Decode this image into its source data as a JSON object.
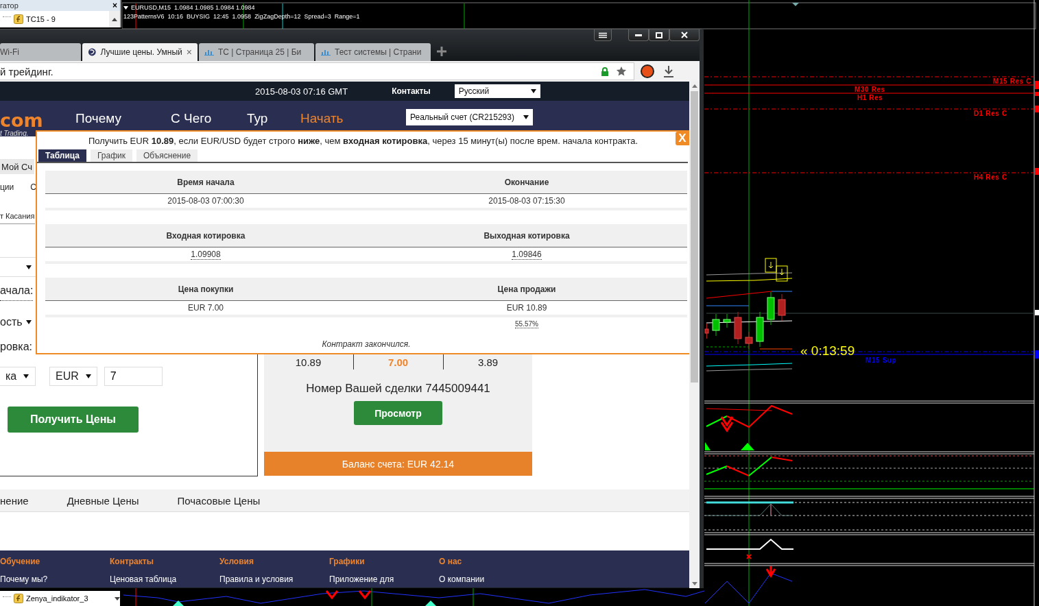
{
  "navigator": {
    "title": "гатор",
    "close": "×",
    "items": [
      {
        "label": "TC15 - 9"
      }
    ],
    "bottom_item": "Zenya_indikator_3"
  },
  "chart": {
    "header": [
      "EURUSD,M15  1.0984 1.0985 1.0984 1.0984",
      "123PatternsV6  10:16  BUYSIG  12:45  1.0958  ZigZagDepth=12  Spread=3  Range=1"
    ],
    "levels": [
      {
        "label": "M15 Res C",
        "color": "#ff0000"
      },
      {
        "label": "M30 Res",
        "color": "#ff0000"
      },
      {
        "label": "H1 Res",
        "color": "#ff0000"
      },
      {
        "label": "D1 Res C",
        "color": "#ff0000"
      },
      {
        "label": "H4 Res C",
        "color": "#ff0000"
      },
      {
        "label": "M15 Sup",
        "color": "#0000ff"
      }
    ],
    "timer": "« 0:13:59"
  },
  "browser": {
    "tabs": [
      {
        "label": "Wi-Fi",
        "selected": false
      },
      {
        "label": "Лучшие цены. Умный",
        "selected": true,
        "close": "×"
      },
      {
        "label": "ТС | Страница 25 | Би",
        "selected": false
      },
      {
        "label": "Тест системы | Страни",
        "selected": false
      }
    ],
    "address": "й трейдинг."
  },
  "site": {
    "datetime": "2015-08-03 07:16 GMT",
    "contacts": "Контакты",
    "language": "Русский",
    "logo": "com",
    "tagline": "t Trading.",
    "nav": [
      {
        "label": "Почему",
        "highlighted": false
      },
      {
        "label": "С Чего",
        "highlighted": false
      },
      {
        "label": "Тур",
        "highlighted": false
      },
      {
        "label": "Начать",
        "highlighted": true
      }
    ],
    "account": "Реальный счет (CR215293)",
    "form": {
      "tab": "Мой Сч",
      "links": [
        "ции",
        "С"
      ],
      "contract_type": "т Касания",
      "start_label": "ачала:",
      "duration": "ость",
      "barrier_label": "ровка:",
      "basis": "ка",
      "currency": "EUR",
      "amount": "7",
      "submit": "Получить Цены"
    },
    "quote": {
      "payouts": [
        {
          "value": "10.89",
          "highlighted": false
        },
        {
          "value": "7.00",
          "highlighted": true
        },
        {
          "value": "3.89",
          "highlighted": false
        }
      ],
      "trade_id": "Номер Вашей сделки 7445009441",
      "view": "Просмотр",
      "balance": "Баланс счета: EUR 42.14"
    },
    "tabs": [
      "нение",
      "Дневные Цены",
      "Почасовые Цены"
    ],
    "footer": [
      {
        "heading": "Обучение",
        "link": "Почему мы?"
      },
      {
        "heading": "Контракты",
        "link": "Ценовая таблица"
      },
      {
        "heading": "Условия",
        "link": "Правила и условия"
      },
      {
        "heading": "Графики",
        "link": "Приложение для"
      },
      {
        "heading": "О нас",
        "link": "О компании"
      }
    ]
  },
  "popup": {
    "message": "Получить EUR **10.89**, если EUR/USD будет строго **ниже**, чем **входная котировка**, через 15 минут(ы) после врем. начала контракта.",
    "close": "X",
    "tabs": [
      {
        "label": "Таблица",
        "selected": true
      },
      {
        "label": "График",
        "selected": false
      },
      {
        "label": "Объяснение",
        "selected": false
      }
    ],
    "sections": [
      {
        "kind": "plain",
        "headers": [
          "Время начала",
          "Окончание"
        ],
        "values": [
          "2015-08-03 07:00:30",
          "2015-08-03 07:15:30"
        ]
      },
      {
        "kind": "quote",
        "headers": [
          "Входная котировка",
          "Выходная котировка"
        ],
        "values": [
          "1.09908",
          "1.09846"
        ]
      },
      {
        "kind": "plain",
        "headers": [
          "Цена покупки",
          "Цена продажи"
        ],
        "values": [
          "EUR 7.00",
          "EUR 10.89"
        ],
        "note": "55.57%"
      }
    ],
    "status": "Контракт закончился."
  }
}
